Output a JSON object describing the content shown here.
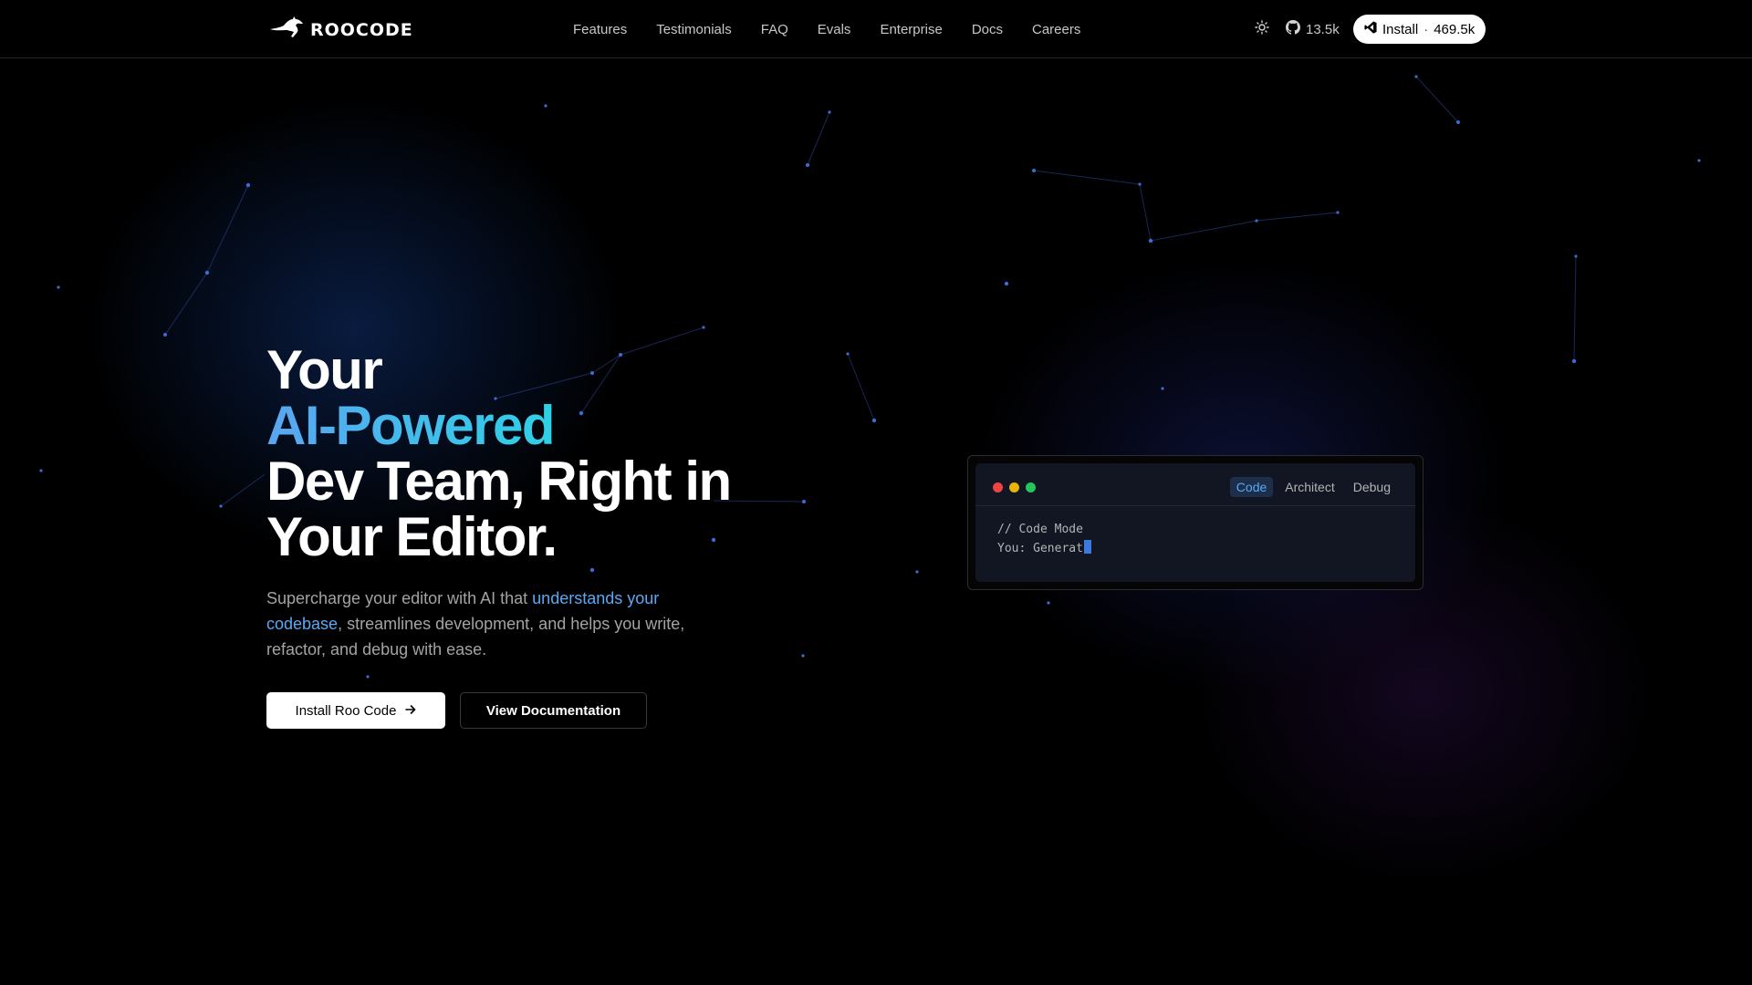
{
  "header": {
    "logo_text": "ROOCODE",
    "nav": [
      "Features",
      "Testimonials",
      "FAQ",
      "Evals",
      "Enterprise",
      "Docs",
      "Careers"
    ],
    "github_stars": "13.5k",
    "install_label": "Install",
    "install_separator": "·",
    "install_count": "469.5k"
  },
  "hero": {
    "title_line1": "Your",
    "title_accent": "AI-Powered",
    "title_line3": "Dev Team, Right in",
    "title_line4": "Your Editor.",
    "subtitle_before": "Supercharge your editor with AI that ",
    "subtitle_highlight": "understands your codebase",
    "subtitle_after": ", streamlines development, and helps you write, refactor, and debug with ease.",
    "primary_button": "Install Roo Code",
    "secondary_button": "View Documentation"
  },
  "editor": {
    "tabs": [
      "Code",
      "Architect",
      "Debug"
    ],
    "active_tab": "Code",
    "code_line1": "// Code Mode",
    "code_line2": "You: Generat"
  },
  "colors": {
    "accent_blue": "#5aa9f5",
    "accent_cyan": "#2ed1e6",
    "dot_red": "#ef4444",
    "dot_yellow": "#eab308",
    "dot_green": "#22c55e"
  }
}
